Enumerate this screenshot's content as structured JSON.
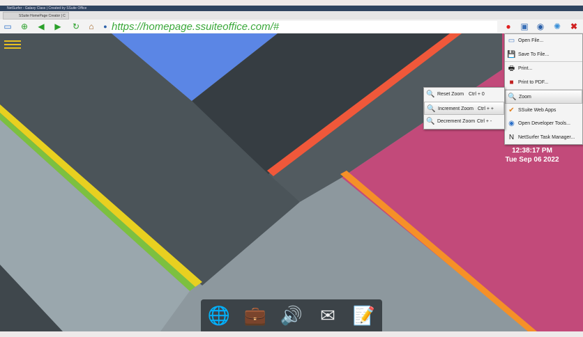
{
  "window": {
    "title": "NetSurfer - Galaxy Class | Created by SSuite Office"
  },
  "tab": {
    "label": "SSuite HomePage Creator | C"
  },
  "toolbar": {
    "url": "https://homepage.ssuiteoffice.com/#"
  },
  "menu": {
    "items": [
      {
        "label": "Open File...",
        "icon": "open-file-icon"
      },
      {
        "label": "Save To File...",
        "icon": "save-icon"
      },
      {
        "label": "Print...",
        "icon": "printer-icon"
      },
      {
        "label": "Print to PDF...",
        "icon": "pdf-icon"
      },
      {
        "label": "Zoom",
        "icon": "magnifier-icon"
      },
      {
        "label": "SSuite Web Apps",
        "icon": "ssuite-icon"
      },
      {
        "label": "Open Developer Tools...",
        "icon": "developer-tools-icon"
      },
      {
        "label": "NetSurfer Task Manager...",
        "icon": "task-manager-icon"
      }
    ]
  },
  "zoom_submenu": {
    "items": [
      {
        "label": "Reset Zoom",
        "shortcut": "Ctrl + 0"
      },
      {
        "label": "Increment Zoom",
        "shortcut": "Ctrl + +"
      },
      {
        "label": "Decrement Zoom",
        "shortcut": "Ctrl + -"
      }
    ]
  },
  "clock": {
    "time": "12:38:17 PM",
    "date": "Tue Sep 06 2022"
  },
  "colors": {
    "accent_url": "#3aa83a",
    "pink": "#c24a7a",
    "blue": "#5b86e5",
    "red_stripe": "#f0583a"
  }
}
